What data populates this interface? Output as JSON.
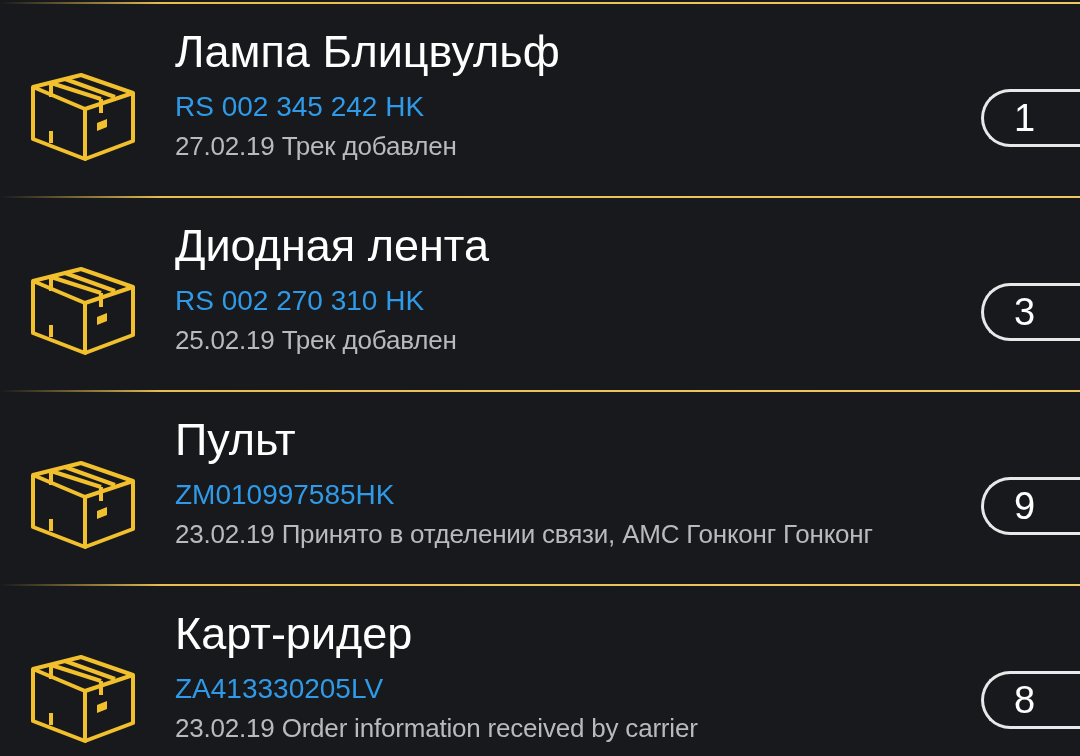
{
  "parcels": [
    {
      "name": "Лампа Блицвульф",
      "track": "RS 002 345 242 HK",
      "status": "27.02.19 Трек добавлен",
      "count": "1"
    },
    {
      "name": "Диодная лента",
      "track": "RS 002 270 310 HK",
      "status": "25.02.19 Трек добавлен",
      "count": "3"
    },
    {
      "name": "Пульт",
      "track": "ZM010997585HK",
      "status": "23.02.19 Принято в отделении связи, AMC Гонконг Гонконг",
      "count": "9"
    },
    {
      "name": "Карт-ридер",
      "track": "ZA413330205LV",
      "status": "23.02.19 Order information received by carrier",
      "count": "8"
    }
  ]
}
